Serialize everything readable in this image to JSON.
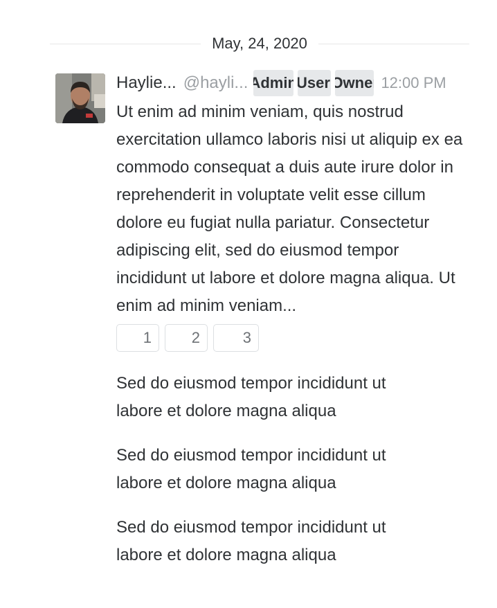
{
  "date_separator": "May, 24, 2020",
  "message": {
    "author_name": "Haylie...",
    "author_handle": "@hayli...",
    "roles": [
      "Admin",
      "User",
      "Owner"
    ],
    "timestamp": "12:00 PM",
    "text": "Ut enim ad minim veniam, quis nostrud exercitation ullamco laboris nisi ut aliquip ex ea commodo consequat a duis aute irure dolor in reprehenderit in voluptate velit esse cillum dolore eu fugiat nulla pariatur. Consectetur adipiscing elit, sed do eiusmod tempor incididunt ut labore et dolore magna aliqua. Ut enim ad minim veniam...",
    "reactions": [
      {
        "count": "1"
      },
      {
        "count": "2"
      },
      {
        "count": "3"
      }
    ]
  },
  "followups": [
    {
      "text": "Sed do eiusmod tempor incididunt ut labore et dolore magna aliqua"
    },
    {
      "text": "Sed do eiusmod tempor incididunt ut labore et dolore magna aliqua"
    },
    {
      "text": "Sed do eiusmod tempor incididunt ut labore et dolore magna aliqua"
    }
  ]
}
